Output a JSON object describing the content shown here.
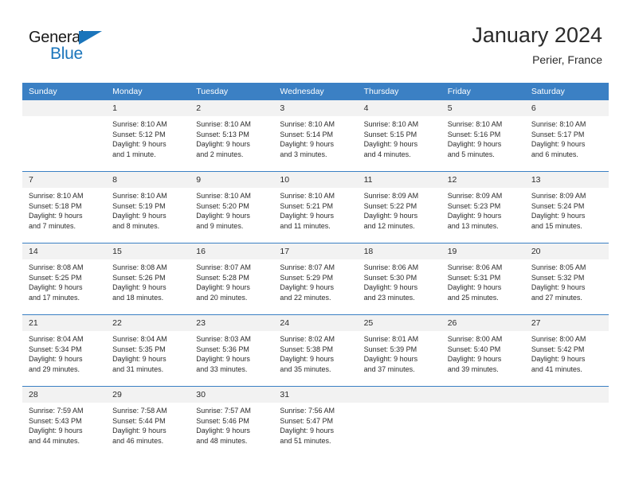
{
  "brand": {
    "name_part1": "General",
    "name_part2": "Blue",
    "accent_color": "#1b75bb"
  },
  "header": {
    "title": "January 2024",
    "subtitle": "Perier, France"
  },
  "theme": {
    "header_row_color": "#3b80c4",
    "daynum_background": "#f2f2f2",
    "text_color": "#2b2b2b"
  },
  "calendar": {
    "weekday_headers": [
      "Sunday",
      "Monday",
      "Tuesday",
      "Wednesday",
      "Thursday",
      "Friday",
      "Saturday"
    ],
    "weeks": [
      [
        {
          "day": "",
          "sunrise": "",
          "sunset": "",
          "daylight1": "",
          "daylight2": ""
        },
        {
          "day": "1",
          "sunrise": "Sunrise: 8:10 AM",
          "sunset": "Sunset: 5:12 PM",
          "daylight1": "Daylight: 9 hours",
          "daylight2": "and 1 minute."
        },
        {
          "day": "2",
          "sunrise": "Sunrise: 8:10 AM",
          "sunset": "Sunset: 5:13 PM",
          "daylight1": "Daylight: 9 hours",
          "daylight2": "and 2 minutes."
        },
        {
          "day": "3",
          "sunrise": "Sunrise: 8:10 AM",
          "sunset": "Sunset: 5:14 PM",
          "daylight1": "Daylight: 9 hours",
          "daylight2": "and 3 minutes."
        },
        {
          "day": "4",
          "sunrise": "Sunrise: 8:10 AM",
          "sunset": "Sunset: 5:15 PM",
          "daylight1": "Daylight: 9 hours",
          "daylight2": "and 4 minutes."
        },
        {
          "day": "5",
          "sunrise": "Sunrise: 8:10 AM",
          "sunset": "Sunset: 5:16 PM",
          "daylight1": "Daylight: 9 hours",
          "daylight2": "and 5 minutes."
        },
        {
          "day": "6",
          "sunrise": "Sunrise: 8:10 AM",
          "sunset": "Sunset: 5:17 PM",
          "daylight1": "Daylight: 9 hours",
          "daylight2": "and 6 minutes."
        }
      ],
      [
        {
          "day": "7",
          "sunrise": "Sunrise: 8:10 AM",
          "sunset": "Sunset: 5:18 PM",
          "daylight1": "Daylight: 9 hours",
          "daylight2": "and 7 minutes."
        },
        {
          "day": "8",
          "sunrise": "Sunrise: 8:10 AM",
          "sunset": "Sunset: 5:19 PM",
          "daylight1": "Daylight: 9 hours",
          "daylight2": "and 8 minutes."
        },
        {
          "day": "9",
          "sunrise": "Sunrise: 8:10 AM",
          "sunset": "Sunset: 5:20 PM",
          "daylight1": "Daylight: 9 hours",
          "daylight2": "and 9 minutes."
        },
        {
          "day": "10",
          "sunrise": "Sunrise: 8:10 AM",
          "sunset": "Sunset: 5:21 PM",
          "daylight1": "Daylight: 9 hours",
          "daylight2": "and 11 minutes."
        },
        {
          "day": "11",
          "sunrise": "Sunrise: 8:09 AM",
          "sunset": "Sunset: 5:22 PM",
          "daylight1": "Daylight: 9 hours",
          "daylight2": "and 12 minutes."
        },
        {
          "day": "12",
          "sunrise": "Sunrise: 8:09 AM",
          "sunset": "Sunset: 5:23 PM",
          "daylight1": "Daylight: 9 hours",
          "daylight2": "and 13 minutes."
        },
        {
          "day": "13",
          "sunrise": "Sunrise: 8:09 AM",
          "sunset": "Sunset: 5:24 PM",
          "daylight1": "Daylight: 9 hours",
          "daylight2": "and 15 minutes."
        }
      ],
      [
        {
          "day": "14",
          "sunrise": "Sunrise: 8:08 AM",
          "sunset": "Sunset: 5:25 PM",
          "daylight1": "Daylight: 9 hours",
          "daylight2": "and 17 minutes."
        },
        {
          "day": "15",
          "sunrise": "Sunrise: 8:08 AM",
          "sunset": "Sunset: 5:26 PM",
          "daylight1": "Daylight: 9 hours",
          "daylight2": "and 18 minutes."
        },
        {
          "day": "16",
          "sunrise": "Sunrise: 8:07 AM",
          "sunset": "Sunset: 5:28 PM",
          "daylight1": "Daylight: 9 hours",
          "daylight2": "and 20 minutes."
        },
        {
          "day": "17",
          "sunrise": "Sunrise: 8:07 AM",
          "sunset": "Sunset: 5:29 PM",
          "daylight1": "Daylight: 9 hours",
          "daylight2": "and 22 minutes."
        },
        {
          "day": "18",
          "sunrise": "Sunrise: 8:06 AM",
          "sunset": "Sunset: 5:30 PM",
          "daylight1": "Daylight: 9 hours",
          "daylight2": "and 23 minutes."
        },
        {
          "day": "19",
          "sunrise": "Sunrise: 8:06 AM",
          "sunset": "Sunset: 5:31 PM",
          "daylight1": "Daylight: 9 hours",
          "daylight2": "and 25 minutes."
        },
        {
          "day": "20",
          "sunrise": "Sunrise: 8:05 AM",
          "sunset": "Sunset: 5:32 PM",
          "daylight1": "Daylight: 9 hours",
          "daylight2": "and 27 minutes."
        }
      ],
      [
        {
          "day": "21",
          "sunrise": "Sunrise: 8:04 AM",
          "sunset": "Sunset: 5:34 PM",
          "daylight1": "Daylight: 9 hours",
          "daylight2": "and 29 minutes."
        },
        {
          "day": "22",
          "sunrise": "Sunrise: 8:04 AM",
          "sunset": "Sunset: 5:35 PM",
          "daylight1": "Daylight: 9 hours",
          "daylight2": "and 31 minutes."
        },
        {
          "day": "23",
          "sunrise": "Sunrise: 8:03 AM",
          "sunset": "Sunset: 5:36 PM",
          "daylight1": "Daylight: 9 hours",
          "daylight2": "and 33 minutes."
        },
        {
          "day": "24",
          "sunrise": "Sunrise: 8:02 AM",
          "sunset": "Sunset: 5:38 PM",
          "daylight1": "Daylight: 9 hours",
          "daylight2": "and 35 minutes."
        },
        {
          "day": "25",
          "sunrise": "Sunrise: 8:01 AM",
          "sunset": "Sunset: 5:39 PM",
          "daylight1": "Daylight: 9 hours",
          "daylight2": "and 37 minutes."
        },
        {
          "day": "26",
          "sunrise": "Sunrise: 8:00 AM",
          "sunset": "Sunset: 5:40 PM",
          "daylight1": "Daylight: 9 hours",
          "daylight2": "and 39 minutes."
        },
        {
          "day": "27",
          "sunrise": "Sunrise: 8:00 AM",
          "sunset": "Sunset: 5:42 PM",
          "daylight1": "Daylight: 9 hours",
          "daylight2": "and 41 minutes."
        }
      ],
      [
        {
          "day": "28",
          "sunrise": "Sunrise: 7:59 AM",
          "sunset": "Sunset: 5:43 PM",
          "daylight1": "Daylight: 9 hours",
          "daylight2": "and 44 minutes."
        },
        {
          "day": "29",
          "sunrise": "Sunrise: 7:58 AM",
          "sunset": "Sunset: 5:44 PM",
          "daylight1": "Daylight: 9 hours",
          "daylight2": "and 46 minutes."
        },
        {
          "day": "30",
          "sunrise": "Sunrise: 7:57 AM",
          "sunset": "Sunset: 5:46 PM",
          "daylight1": "Daylight: 9 hours",
          "daylight2": "and 48 minutes."
        },
        {
          "day": "31",
          "sunrise": "Sunrise: 7:56 AM",
          "sunset": "Sunset: 5:47 PM",
          "daylight1": "Daylight: 9 hours",
          "daylight2": "and 51 minutes."
        },
        {
          "day": "",
          "sunrise": "",
          "sunset": "",
          "daylight1": "",
          "daylight2": ""
        },
        {
          "day": "",
          "sunrise": "",
          "sunset": "",
          "daylight1": "",
          "daylight2": ""
        },
        {
          "day": "",
          "sunrise": "",
          "sunset": "",
          "daylight1": "",
          "daylight2": ""
        }
      ]
    ]
  }
}
